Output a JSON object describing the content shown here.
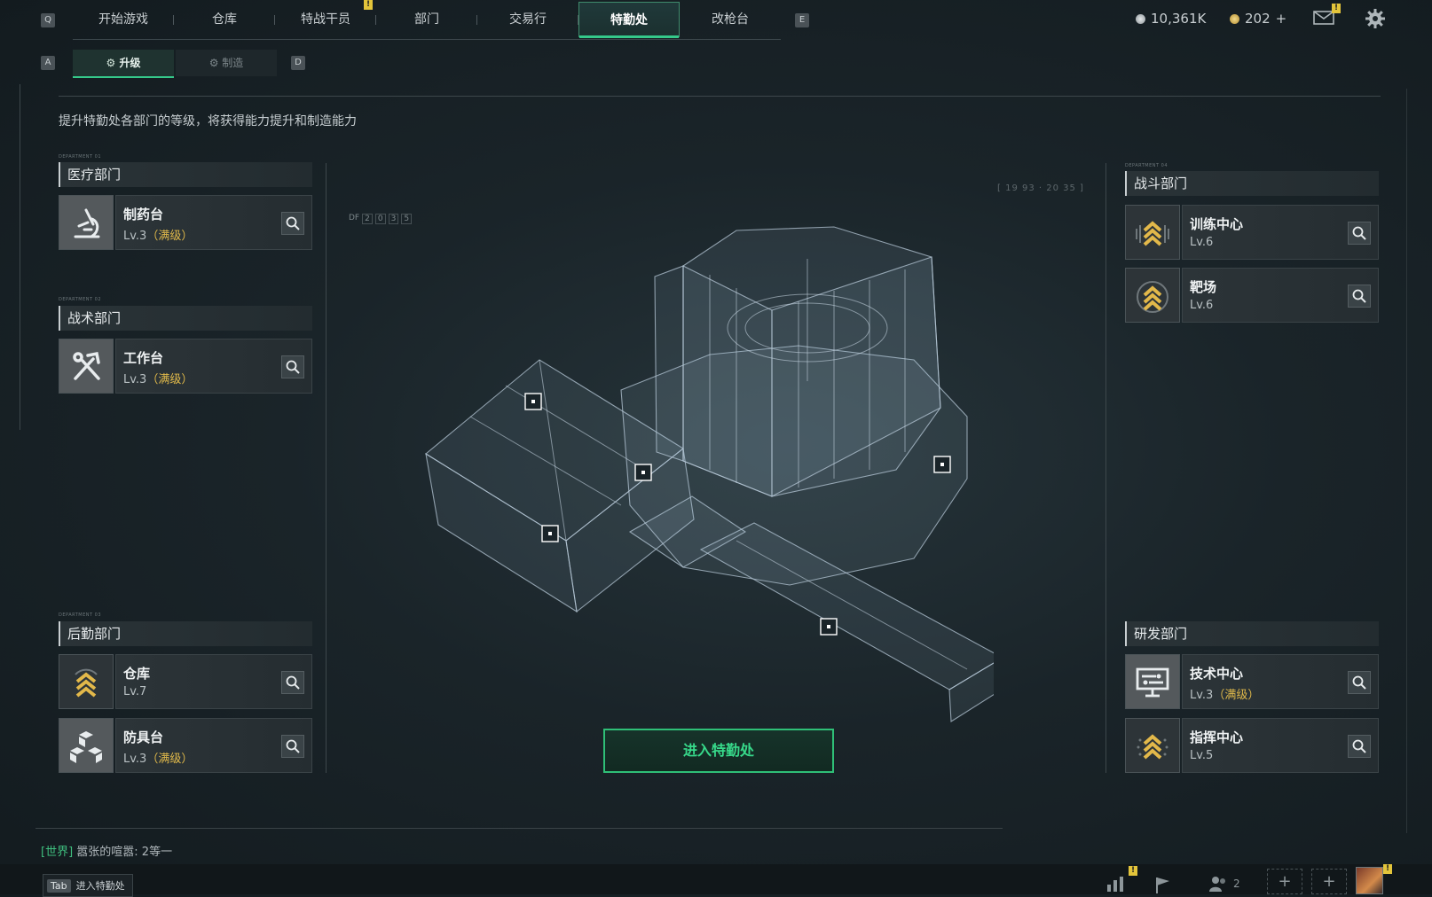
{
  "nav": {
    "key_left": "Q",
    "key_right": "E",
    "tabs": [
      {
        "label": "开始游戏",
        "active": false
      },
      {
        "label": "仓库",
        "active": false
      },
      {
        "label": "特战干员",
        "active": false,
        "badge": "!"
      },
      {
        "label": "部门",
        "active": false
      },
      {
        "label": "交易行",
        "active": false
      },
      {
        "label": "特勤处",
        "active": true
      },
      {
        "label": "改枪台",
        "active": false
      }
    ],
    "currency_silver": "10,361K",
    "currency_gold": "202",
    "currency_add": "+",
    "mail_badge": "!"
  },
  "subtabs": {
    "key_left": "A",
    "key_right": "D",
    "upgrade": "升级",
    "craft": "制造"
  },
  "description": "提升特勤处各部门的等级，将获得能力提升和制造能力",
  "departments": {
    "medical": {
      "tiny": "DEPARTMENT 01",
      "title": "医疗部门",
      "items": [
        {
          "name": "制药台",
          "level": "Lv.3",
          "max": "（满级）",
          "icon": "microscope-icon"
        }
      ]
    },
    "tactical": {
      "tiny": "DEPARTMENT 02",
      "title": "战术部门",
      "items": [
        {
          "name": "工作台",
          "level": "Lv.3",
          "max": "（满级）",
          "icon": "hammer-wrench-icon"
        }
      ]
    },
    "logistics": {
      "tiny": "DEPARTMENT 03",
      "title": "后勤部门",
      "items": [
        {
          "name": "仓库",
          "level": "Lv.7",
          "max": "",
          "icon": "chevron-rank-icon"
        },
        {
          "name": "防具台",
          "level": "Lv.3",
          "max": "（满级）",
          "icon": "cubes-icon"
        }
      ]
    },
    "combat": {
      "tiny": "DEPARTMENT 04",
      "title": "战斗部门",
      "items": [
        {
          "name": "训练中心",
          "level": "Lv.6",
          "max": "",
          "icon": "chevron-rank-icon"
        },
        {
          "name": "靶场",
          "level": "Lv.6",
          "max": "",
          "icon": "target-rank-icon"
        }
      ]
    },
    "research": {
      "title": "研发部门",
      "items": [
        {
          "name": "技术中心",
          "level": "Lv.3",
          "max": "（满级）",
          "icon": "monitor-icon"
        },
        {
          "name": "指挥中心",
          "level": "Lv.5",
          "max": "",
          "icon": "chevron-rank-icon"
        }
      ]
    }
  },
  "hud": {
    "code_prefix": "DF",
    "code_digits": [
      "2",
      "0",
      "3",
      "5"
    ],
    "time_readout": "[ 19 93 · 20 35 ]"
  },
  "enter_button": "进入特勤处",
  "chat": {
    "channel": "[世界]",
    "message": "嚣张的喧嚣: 2等一"
  },
  "bottom": {
    "tab_key": "Tab",
    "tab_label": "进入特勤处",
    "friends_count": "2",
    "badge": "!"
  },
  "colors": {
    "accent_green": "#35c98a",
    "maxed_gold": "#e0b94a",
    "badge_yellow": "#e3c43a"
  }
}
